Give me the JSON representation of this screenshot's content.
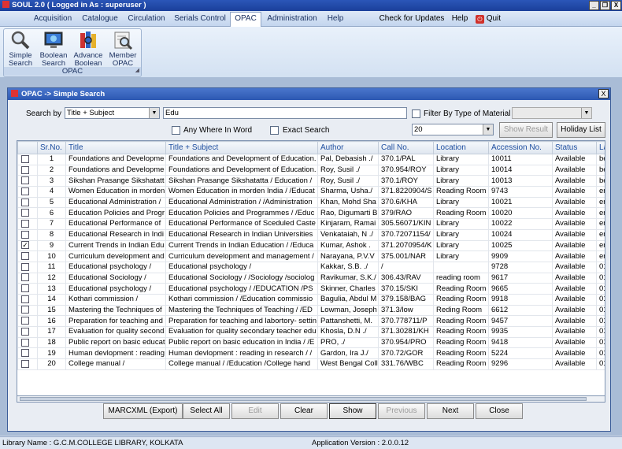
{
  "window": {
    "title": "SOUL 2.0  ( Logged in As : superuser )",
    "min": "_",
    "restore": "❐",
    "close": "X"
  },
  "menu": {
    "tabs": [
      {
        "label": "Acquisition",
        "active": false
      },
      {
        "label": "Catalogue",
        "active": false
      },
      {
        "label": "Circulation",
        "active": false
      },
      {
        "label": "Serials Control",
        "active": false
      },
      {
        "label": "OPAC",
        "active": true
      },
      {
        "label": "Administration",
        "active": false
      },
      {
        "label": "Help",
        "active": false
      }
    ],
    "updates": "Check for Updates",
    "help": "Help",
    "quit": "Quit"
  },
  "ribbon": {
    "group_label": "OPAC",
    "buttons": [
      {
        "line1": "Simple",
        "line2": "Search",
        "icon": "magnifier-icon"
      },
      {
        "line1": "Boolean",
        "line2": "Search",
        "icon": "monitor-globe-icon"
      },
      {
        "line1": "Advance",
        "line2": "Boolean",
        "icon": "books-icon"
      },
      {
        "line1": "Member",
        "line2": "OPAC",
        "icon": "member-search-icon"
      }
    ]
  },
  "child": {
    "title": "OPAC -> Simple Search",
    "search_by_label": "Search by",
    "search_by_value": "Title + Subject",
    "search_text": "Edu",
    "filter_label": "Filter By Type of Material",
    "any_where_label": "Any Where In Word",
    "exact_search_label": "Exact Search",
    "count_value": "20",
    "show_result": "Show Result",
    "holiday_list": "Holiday List"
  },
  "grid": {
    "columns": [
      "",
      "Sr.No.",
      "Title",
      "Title + Subject",
      "Author",
      "Call No.",
      "Location",
      "Accession No.",
      "Status",
      "La"
    ],
    "rows": [
      {
        "checked": false,
        "sr": "1",
        "title": "Foundations and Developme",
        "subject": "Foundations and Development of Education.",
        "author": "Pal, Debasish  ./",
        "call": "370.1/PAL",
        "location": "Library",
        "acc": "10011",
        "status": "Available",
        "lang": "be"
      },
      {
        "checked": false,
        "sr": "2",
        "title": "Foundations and Developme",
        "subject": "Foundations and Development of Education.",
        "author": "Roy, Susil  ./",
        "call": "370.954/ROY",
        "location": "Library",
        "acc": "10014",
        "status": "Available",
        "lang": "be"
      },
      {
        "checked": false,
        "sr": "3",
        "title": "Sikshan Prasange Sikshatatt",
        "subject": "Sikshan Prasange Sikshatatta / Education /",
        "author": "Roy, Susil  ./",
        "call": "370.1/ROY",
        "location": "Library",
        "acc": "10013",
        "status": "Available",
        "lang": "be"
      },
      {
        "checked": false,
        "sr": "4",
        "title": "Women Education in morden",
        "subject": "Women Education in morden India / /Educat",
        "author": "Sharma, Usha./",
        "call": "371.8220904/S",
        "location": "Reading Room",
        "acc": "9743",
        "status": "Available",
        "lang": "en"
      },
      {
        "checked": false,
        "sr": "5",
        "title": "Educational Administration /",
        "subject": "Educational Administration / /Administration",
        "author": "Khan, Mohd Sha",
        "call": "370.6/KHA",
        "location": "Library",
        "acc": "10021",
        "status": "Available",
        "lang": "en"
      },
      {
        "checked": false,
        "sr": "6",
        "title": "Education Policies and Progr",
        "subject": "Education Policies and Programmes / /Educ",
        "author": "Rao, Digumarti B",
        "call": "379/RAO",
        "location": "Reading Room",
        "acc": "10020",
        "status": "Available",
        "lang": "en"
      },
      {
        "checked": false,
        "sr": "7",
        "title": "Educational Performance of",
        "subject": "Educational Performance of Sceduled Caste",
        "author": "Kinjaram, Ramai",
        "call": "305.56071/KIN",
        "location": "Library",
        "acc": "10022",
        "status": "Available",
        "lang": "en"
      },
      {
        "checked": false,
        "sr": "8",
        "title": "Educational Research in Indi",
        "subject": "Educational Research in Indian Universities",
        "author": "Venkataiah, N  ./",
        "call": "370.72071154/",
        "location": "Library",
        "acc": "10024",
        "status": "Available",
        "lang": "en"
      },
      {
        "checked": true,
        "sr": "9",
        "title": "Current Trends in Indian Edu",
        "subject": "Current Trends in Indian Education / /Educa",
        "author": " Kumar, Ashok  .",
        "call": "371.2070954/K",
        "location": "Library",
        "acc": "10025",
        "status": "Available",
        "lang": "en"
      },
      {
        "checked": false,
        "sr": "10",
        "title": "Curriculum development and",
        "subject": "Curriculum development and management /",
        "author": "Narayana, P.V.V",
        "call": "375.001/NAR",
        "location": "Library",
        "acc": "9909",
        "status": "Available",
        "lang": "en"
      },
      {
        "checked": false,
        "sr": "11",
        "title": "Educational psychology /",
        "subject": "Educational psychology /",
        "author": "Kakkar, S.B. ./",
        "call": "/",
        "location": "",
        "acc": "9728",
        "status": "Available",
        "lang": "01"
      },
      {
        "checked": false,
        "sr": "12",
        "title": "Educational Sociology /",
        "subject": "Educational Sociology / /Sociology /sociolog",
        "author": "Ravikumar, S.K./",
        "call": "306.43/RAV",
        "location": "reading room",
        "acc": "9617",
        "status": "Available",
        "lang": "01"
      },
      {
        "checked": false,
        "sr": "13",
        "title": "Educational psychology /",
        "subject": "Educational psychology / /EDUCATION /PS",
        "author": "Skinner, Charles",
        "call": "370.15/SKI",
        "location": "Reading Room",
        "acc": "9665",
        "status": "Available",
        "lang": "01"
      },
      {
        "checked": false,
        "sr": "14",
        "title": "Kothari commission /",
        "subject": "Kothari commission / /Education commissio",
        "author": "Bagulia, Abdul M",
        "call": "379.158/BAG",
        "location": "Reading Room",
        "acc": "9918",
        "status": "Available",
        "lang": "01"
      },
      {
        "checked": false,
        "sr": "15",
        "title": "Mastering the Techniques of",
        "subject": "Mastering the Techniques of Teaching / /ED",
        "author": "Lowman, Joseph",
        "call": "371.3/low",
        "location": "Reding Room",
        "acc": "6612",
        "status": "Available",
        "lang": "01"
      },
      {
        "checked": false,
        "sr": "16",
        "title": "Preparation for teaching and",
        "subject": "Preparation for teaching and labortory- settin",
        "author": "Pattanshetti, M.",
        "call": "370.778711/P",
        "location": "Reading Room",
        "acc": "9457",
        "status": "Available",
        "lang": "01"
      },
      {
        "checked": false,
        "sr": "17",
        "title": "Evaluation for quality second",
        "subject": "Evaluation for quality secondary teacher edu",
        "author": "Khosla, D.N  ./",
        "call": "371.30281/KH",
        "location": "Reading Room",
        "acc": "9935",
        "status": "Available",
        "lang": "01"
      },
      {
        "checked": false,
        "sr": "18",
        "title": "Public report on basic educat",
        "subject": "Public report on basic education in India / /E",
        "author": "PRO,  ./",
        "call": "370.954/PRO",
        "location": "Reading Room",
        "acc": "9418",
        "status": "Available",
        "lang": "01"
      },
      {
        "checked": false,
        "sr": "19",
        "title": "Human devlopment : reading",
        "subject": "Human devlopment : reading in research / /",
        "author": "Gardon, Ira J./",
        "call": "370.72/GOR",
        "location": "Reading Room",
        "acc": "5224",
        "status": "Available",
        "lang": "01"
      },
      {
        "checked": false,
        "sr": "20",
        "title": "College manual /",
        "subject": "College manual / /Education /College hand",
        "author": "West Bengal Coll",
        "call": "331.76/WBC",
        "location": "Reading Room",
        "acc": "9296",
        "status": "Available",
        "lang": "01"
      }
    ]
  },
  "buttons": {
    "marcxml": "MARCXML (Export)",
    "select_all": "Select All",
    "edit": "Edit",
    "clear": "Clear",
    "show": "Show",
    "previous": "Previous",
    "next": "Next",
    "close": "Close"
  },
  "status": {
    "library": "Library Name : G.C.M.COLLEGE LIBRARY, KOLKATA",
    "version": "Application Version : 2.0.0.12"
  },
  "colors": {
    "titlebar": "#2b56b8",
    "header_text": "#1f4fa0",
    "quit_icon": "#d0302a"
  }
}
